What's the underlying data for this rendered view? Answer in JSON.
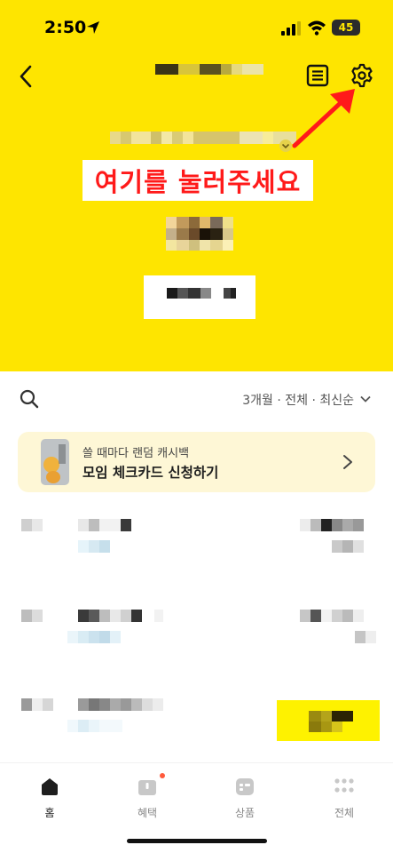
{
  "status_bar": {
    "time": "2:50",
    "battery": "45"
  },
  "header": {
    "back_icon": "chevron-left-icon",
    "list_icon": "list-icon",
    "settings_icon": "gear-icon"
  },
  "annotation": {
    "text": "여기를 눌러주세요",
    "color": "#ff1a1a"
  },
  "filter": {
    "label": "3개월 · 전체 · 최신순"
  },
  "promo": {
    "subtitle": "쓸 때마다 랜덤 캐시백",
    "title": "모임 체크카드 신청하기"
  },
  "tabs": [
    {
      "label": "홈",
      "icon": "home-icon",
      "active": true
    },
    {
      "label": "혜택",
      "icon": "gift-icon",
      "badge": true
    },
    {
      "label": "상품",
      "icon": "product-icon"
    },
    {
      "label": "전체",
      "icon": "more-dots-icon"
    }
  ],
  "colors": {
    "brand_yellow": "#FEE500",
    "promo_bg": "#FEF7D6",
    "badge": "#ff5a3c"
  }
}
